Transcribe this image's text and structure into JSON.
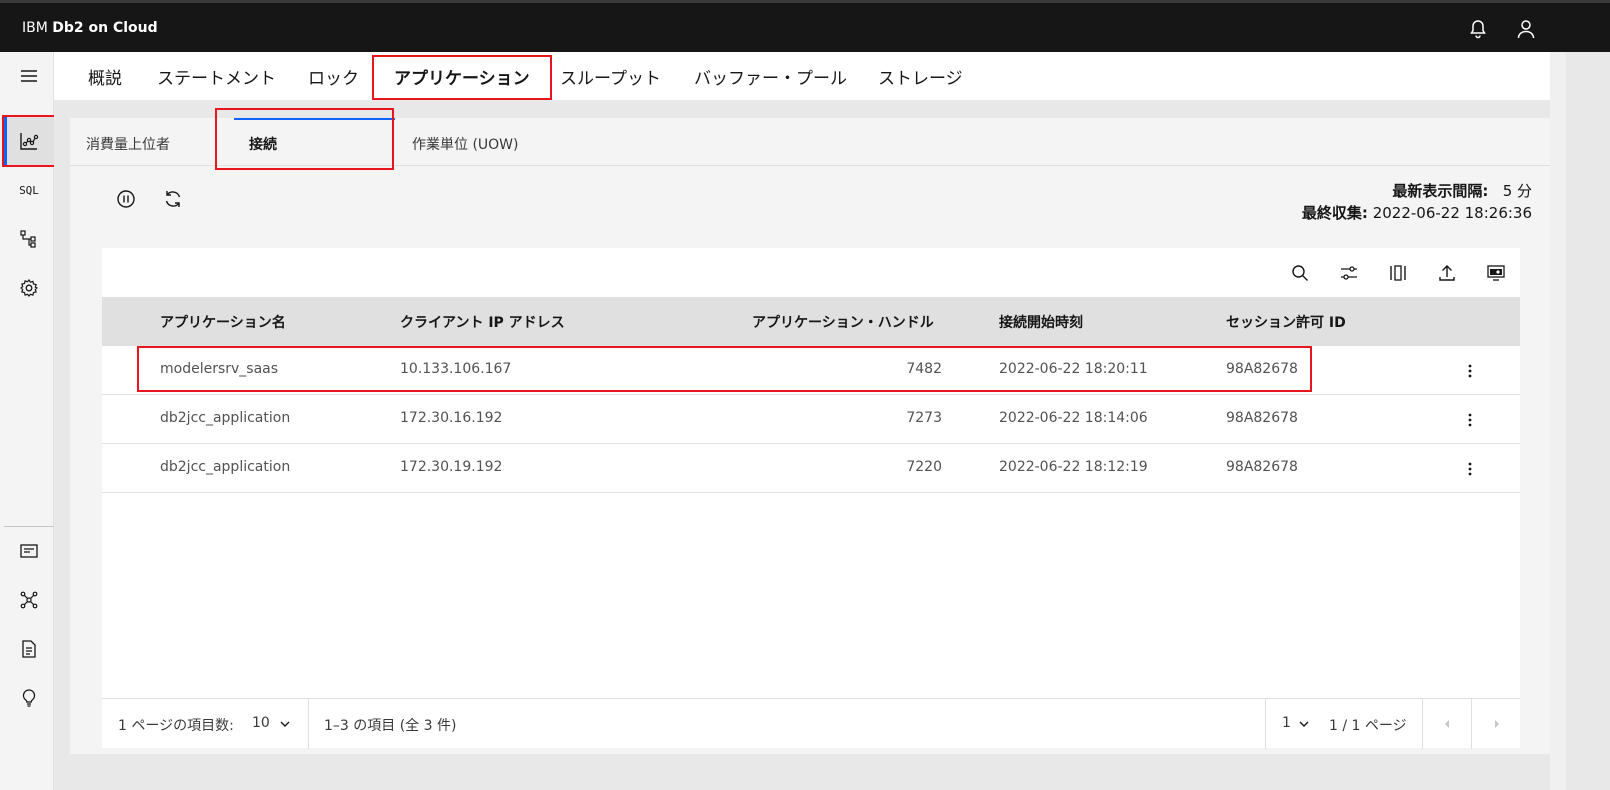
{
  "app": {
    "brand_prefix": "IBM",
    "brand_name": "Db2 on Cloud"
  },
  "topbar": {
    "icons": [
      "notification-icon",
      "user-icon"
    ]
  },
  "sidenav": {
    "icons": [
      "menu-icon",
      "monitor-chart-icon",
      "sql-icon",
      "hierarchy-icon",
      "settings-icon",
      "document-list-icon",
      "network-icon",
      "document-icon",
      "lightbulb-icon"
    ],
    "sql_label": "SQL"
  },
  "tabs": [
    "概説",
    "ステートメント",
    "ロック",
    "アプリケーション",
    "スループット",
    "バッファー・プール",
    "ストレージ"
  ],
  "active_tab": "アプリケーション",
  "subtabs": [
    "消費量上位者",
    "接続",
    "作業単位 (UOW)"
  ],
  "active_subtab": "接続",
  "refresh": {
    "interval_label": "最新表示間隔:",
    "interval_value": "5 分",
    "collected_label": "最終収集:",
    "collected_value": "2022-06-22 18:26:36"
  },
  "table": {
    "columns": [
      "アプリケーション名",
      "クライアント IP アドレス",
      "アプリケーション・ハンドル",
      "接続開始時刻",
      "セッション許可 ID"
    ],
    "rows": [
      [
        "modelersrv_saas",
        "10.133.106.167",
        "7482",
        "2022-06-22 18:20:11",
        "98A82678"
      ],
      [
        "db2jcc_application",
        "172.30.16.192",
        "7273",
        "2022-06-22 18:14:06",
        "98A82678"
      ],
      [
        "db2jcc_application",
        "172.30.19.192",
        "7220",
        "2022-06-22 18:12:19",
        "98A82678"
      ]
    ]
  },
  "pagination": {
    "items_per_page_label": "1 ページの項目数:",
    "items_per_page_value": "10",
    "range_text": "1–3 の項目 (全 3 件)",
    "page_value": "1",
    "page_total_text": "1 / 1 ページ"
  },
  "colors": {
    "accent": "#0f62fe",
    "highlight": "#e8161b",
    "topbar": "#161616"
  }
}
